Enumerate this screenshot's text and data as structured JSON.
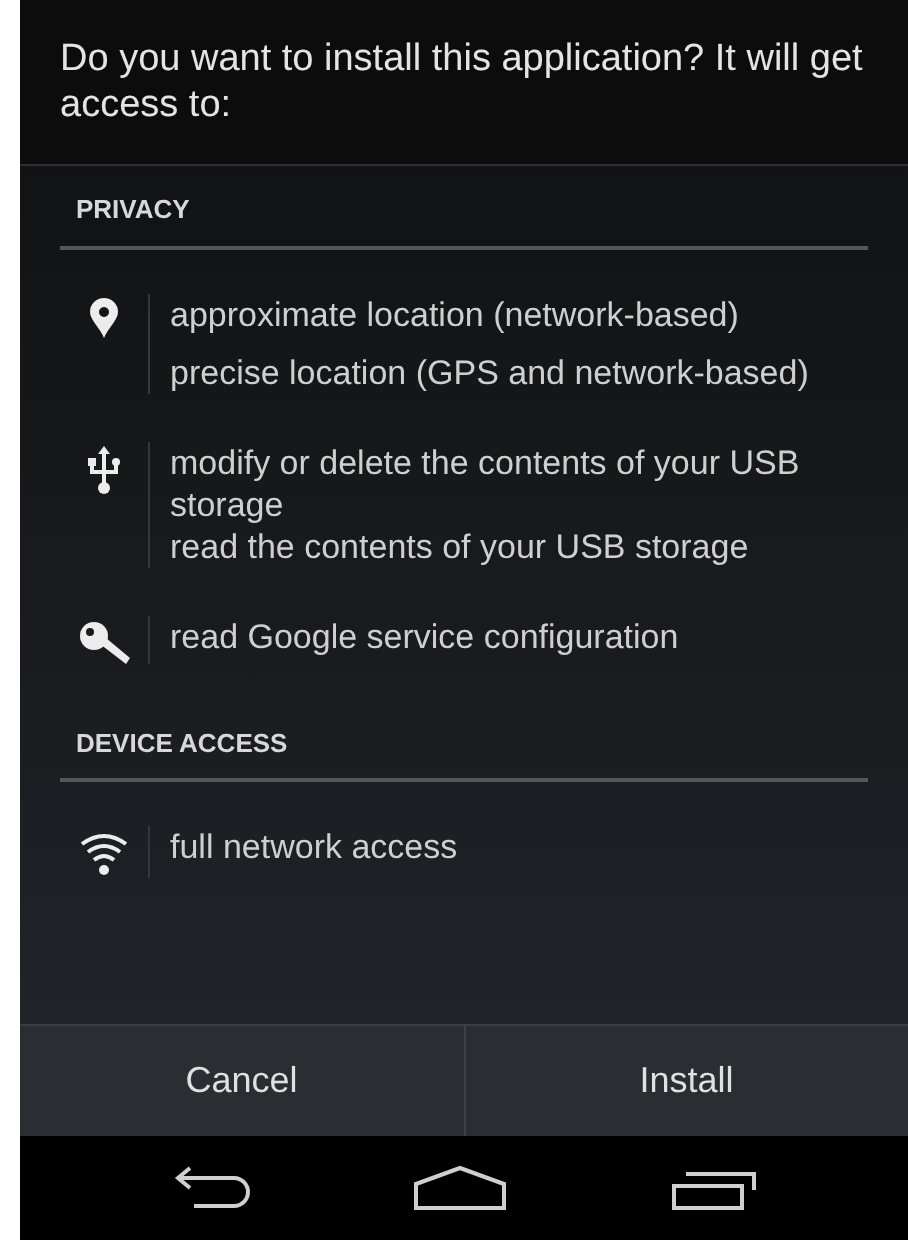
{
  "dialog": {
    "title": "Do you want to install this application? It will get access to:"
  },
  "sections": [
    {
      "heading": "PRIVACY",
      "groups": [
        {
          "kind": "location",
          "items": [
            "approximate location (network-based)",
            "precise location (GPS and network-based)"
          ]
        },
        {
          "kind": "usb",
          "items": [
            "modify or delete the contents of your USB storage",
            "read the contents of your USB storage"
          ]
        },
        {
          "kind": "key",
          "items": [
            "read Google service configuration"
          ]
        }
      ]
    },
    {
      "heading": "DEVICE ACCESS",
      "groups": [
        {
          "kind": "wifi",
          "items": [
            "full network access"
          ]
        }
      ]
    }
  ],
  "buttons": [
    "Cancel",
    "Install"
  ]
}
